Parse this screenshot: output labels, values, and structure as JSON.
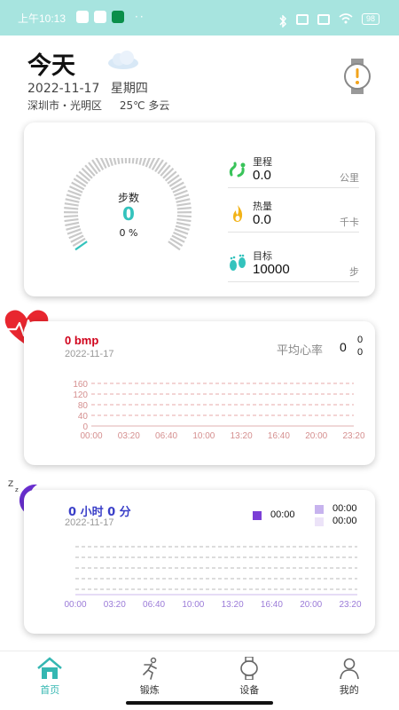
{
  "status_bar": {
    "time": "上午10:13",
    "battery": "98",
    "left_icons": [
      "download-icon",
      "play-store-icon",
      "green-app-icon"
    ],
    "more": "··"
  },
  "header": {
    "title": "今天",
    "date": "2022-11-17",
    "weekday": "星期四",
    "location": "深圳市・光明区",
    "weather": "25℃ 多云",
    "weather_icon": "cloud-icon",
    "alert_icon": "watch-alert-icon"
  },
  "steps": {
    "label": "步数",
    "value": "0",
    "percent": "0 %",
    "progress": 0,
    "accent": "#34c3bd",
    "metrics": [
      {
        "label": "里程",
        "value": "0.0",
        "unit": "公里",
        "icon": "distance-icon"
      },
      {
        "label": "热量",
        "value": "0.0",
        "unit": "千卡",
        "icon": "flame-icon"
      },
      {
        "label": "目标",
        "value": "10000",
        "unit": "步",
        "icon": "footprints-icon"
      }
    ]
  },
  "heart": {
    "value": "0 bmp",
    "date": "2022-11-17",
    "avg_label": "平均心率",
    "avg_value": "0",
    "max_value": "0",
    "min_value": "0",
    "accent": "#d0021b",
    "y_ticks": [
      "160",
      "120",
      "80",
      "40",
      "0"
    ],
    "x_ticks": [
      "00:00",
      "03:20",
      "06:40",
      "10:00",
      "13:20",
      "16:40",
      "20:00",
      "23:20"
    ]
  },
  "sleep": {
    "value": "0 小时 0 分",
    "date": "2022-11-17",
    "accent": "#7b3fd6",
    "legend": [
      {
        "value": "00:00",
        "color": "#7b3fd6"
      },
      {
        "value": "00:00",
        "color": "#c7b3ee"
      },
      {
        "value": "00:00",
        "color": "#ece3f8"
      }
    ],
    "x_ticks": [
      "00:00",
      "03:20",
      "06:40",
      "10:00",
      "13:20",
      "16:40",
      "20:00",
      "23:20"
    ]
  },
  "nav": [
    {
      "label": "首页",
      "icon": "home-icon",
      "active": true
    },
    {
      "label": "锻炼",
      "icon": "running-icon",
      "active": false
    },
    {
      "label": "设备",
      "icon": "watch-icon",
      "active": false
    },
    {
      "label": "我的",
      "icon": "person-icon",
      "active": false
    }
  ]
}
